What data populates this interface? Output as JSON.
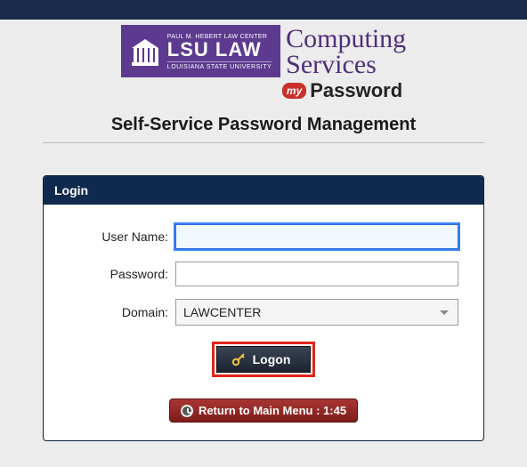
{
  "logo": {
    "top_small": "PAUL M. HEBERT LAW CENTER",
    "big": "LSU LAW",
    "sub": "LOUISIANA STATE UNIVERSITY",
    "computing": "Computing",
    "services": "Services",
    "my": "my",
    "password": "Password"
  },
  "page_title": "Self-Service Password Management",
  "panel": {
    "title": "Login",
    "username_label": "User Name:",
    "username_value": "",
    "password_label": "Password:",
    "password_value": "",
    "domain_label": "Domain:",
    "domain_value": "LAWCENTER",
    "logon_label": "Logon",
    "return_label": "Return to Main Menu : 1:45"
  }
}
